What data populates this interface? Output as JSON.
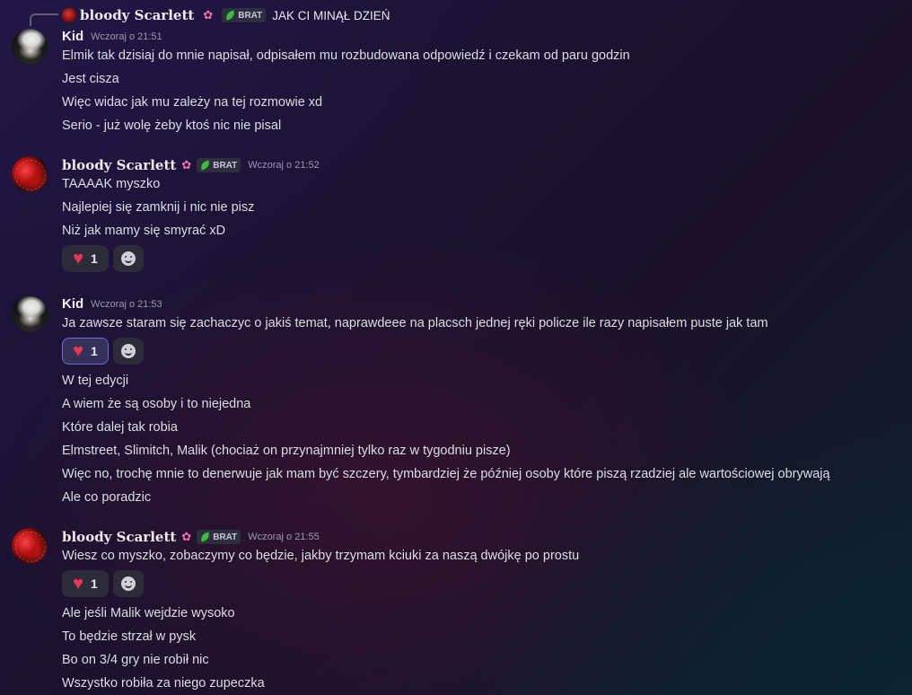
{
  "reply": {
    "author": "bloody Scarlett",
    "role": "BRAT",
    "text": "JAK CI MINĄŁ DZIEŃ"
  },
  "messages": [
    {
      "author": "Kid",
      "time": "Wczoraj o 21:51",
      "lines": [
        "Elmik tak dzisiaj do mnie napisał, odpisałem mu rozbudowana odpowiedź i czekam od paru godzin",
        "Jest cisza",
        "Więc widac jak mu zależy na tej rozmowie xd",
        "Serio - już wolę żeby ktoś nic nie pisal"
      ]
    },
    {
      "author": "bloody Scarlett",
      "role": "BRAT",
      "time": "Wczoraj o 21:52",
      "lines": [
        "TAAAAK myszko",
        "Najlepiej się zamknij i nic nie pisz",
        "Niż jak mamy się smyrać xD"
      ],
      "reaction": {
        "emoji": "heart",
        "count": "1",
        "active": false
      }
    },
    {
      "author": "Kid",
      "time": "Wczoraj o 21:53",
      "lines": [
        "Ja zawsze staram się zachaczyc o jakiś temat, naprawdeee na placsch jednej ręki policze ile razy napisałem puste jak tam"
      ],
      "reaction": {
        "emoji": "heart",
        "count": "1",
        "active": true
      },
      "after_lines": [
        "W tej edycji",
        "A wiem że są osoby i to niejedna",
        "Które dalej tak robia",
        "Elmstreet, Slimitch, Malik (chociaż on przynajmniej tylko raz w tygodniu pisze)",
        "Więc no, trochę mnie to denerwuje jak mam być szczery, tymbardziej że później osoby które piszą rzadziej ale wartościowej obrywają",
        "Ale co poradzic"
      ]
    },
    {
      "author": "bloody Scarlett",
      "role": "BRAT",
      "time": "Wczoraj o 21:55",
      "lines": [
        "Wiesz co myszko, zobaczymy co będzie, jakby trzymam kciuki za naszą dwójkę po prostu"
      ],
      "reaction": {
        "emoji": "heart",
        "count": "1",
        "active": false
      },
      "after_lines": [
        "Ale jeśli Malik wejdzie wysoko",
        "To będzie strzał w pysk",
        "Bo on 3/4 gry nie robił nic",
        "Wszystko robiła za niego zupeczka"
      ]
    }
  ],
  "icons": {
    "heart": "red-heart-emoji",
    "add_reaction": "smile-icon",
    "role": "leaf-icon",
    "flower": "cherry-blossom-emoji"
  },
  "colors": {
    "heart": "#e8384f",
    "active_reaction_border": "#6f6bd8",
    "role_leaf": "#3fba3f"
  }
}
